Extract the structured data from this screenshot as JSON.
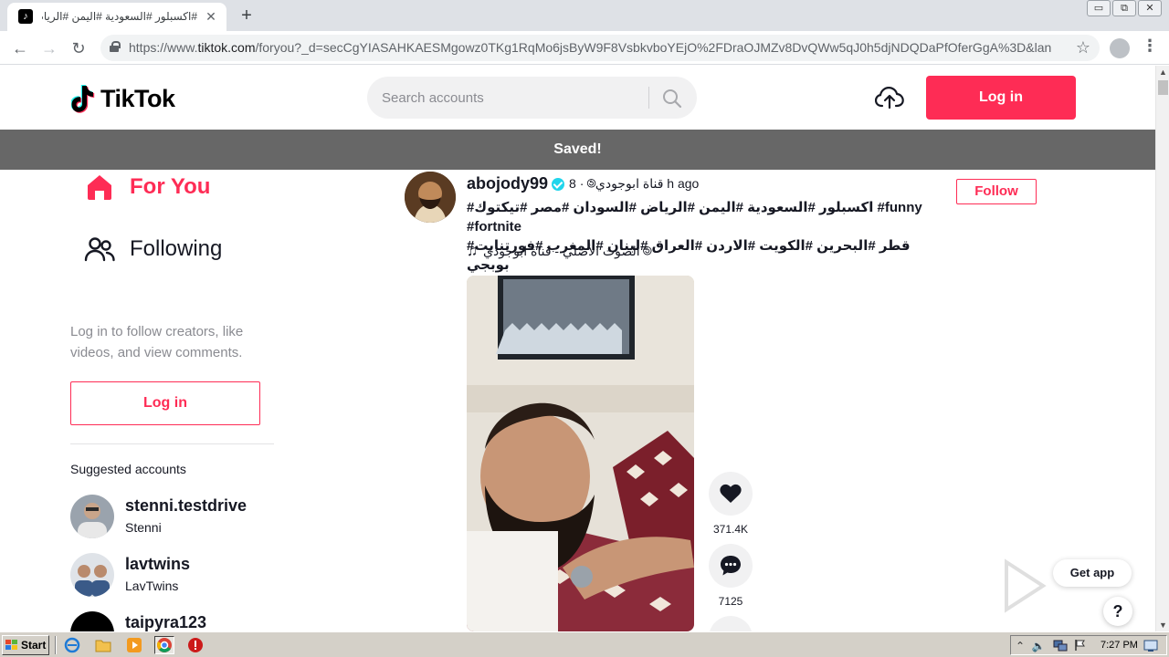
{
  "browser": {
    "tab_title": "#اكسبلور #السعودية #اليمن #الرياض",
    "tab_close": "✕",
    "new_tab": "+",
    "window_buttons": [
      "▭",
      "⧉",
      "✕"
    ],
    "url_prefix": "https://www.",
    "url_host": "tiktok.com",
    "url_rest": "/foryou?_d=secCgYIASAHKAESMgowz0TKg1RqMo6jsByW9F8VsbkvboYEjO%2FDraOJMZv8DvQWw5qJ0h5djNDQDaPfOferGgA%3D&langua…",
    "back": "←",
    "forward": "→",
    "reload": "↻",
    "star": "☆",
    "menu": "⋮"
  },
  "header": {
    "logo_text": "TikTok",
    "search_placeholder": "Search accounts",
    "login_label": "Log in"
  },
  "banner": {
    "text": "Saved!"
  },
  "sidebar": {
    "nav": [
      {
        "label": "For You",
        "icon": "home-icon",
        "active": true
      },
      {
        "label": "Following",
        "icon": "people-icon",
        "active": false
      }
    ],
    "login_message": "Log in to follow creators, like videos, and view comments.",
    "login_label": "Log in",
    "suggested_title": "Suggested accounts",
    "suggested": [
      {
        "username": "stenni.testdrive",
        "nickname": "Stenni"
      },
      {
        "username": "lavtwins",
        "nickname": "LavTwins"
      },
      {
        "username": "taipyra123",
        "nickname": ""
      }
    ]
  },
  "post": {
    "username": "abojody99",
    "meta": "8 · 🄎قناة ابوجودي h ago",
    "caption_line1": "#اكسبلور #السعودية #اليمن #الرياض #السودان #مصر #تيكتوك #funny #fortnite",
    "caption_line2": "#قطر #البحرين #الكويت #الاردن #العراق #لبنان #المغرب #فورتنايت بوبجي",
    "music": "الصوت الأصلي - قناة ابوجودي 🄎",
    "follow_label": "Follow",
    "likes": "371.4K",
    "comments": "7125"
  },
  "floating": {
    "get_app": "Get app",
    "help": "?"
  },
  "watermark": "ANY RUN",
  "taskbar": {
    "start_label": "Start",
    "clock": "7:27 PM"
  },
  "colors": {
    "brand": "#fe2c55",
    "banner": "#676767",
    "verified": "#20d5ec"
  }
}
